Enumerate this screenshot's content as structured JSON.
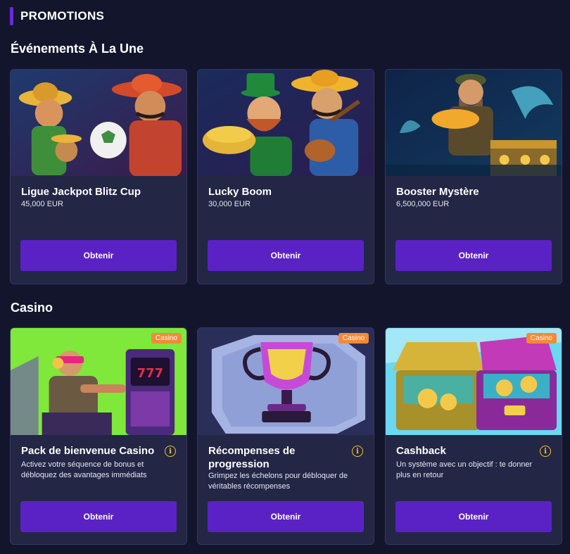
{
  "header": {
    "title": "PROMOTIONS"
  },
  "featured": {
    "title": "Événements À La Une",
    "cards": [
      {
        "title": "Ligue Jackpot Blitz Cup",
        "amount": "45,000 EUR",
        "button": "Obtenir"
      },
      {
        "title": "Lucky Boom",
        "amount": "30,000 EUR",
        "button": "Obtenir"
      },
      {
        "title": "Booster Mystère",
        "amount": "6,500,000 EUR",
        "button": "Obtenir"
      }
    ]
  },
  "casino": {
    "title": "Casino",
    "cards": [
      {
        "badge": "Casino",
        "title": "Pack de bienvenue Casino",
        "description": "Activez votre séquence de bonus et débloquez des avantages immédiats",
        "button": "Obtenir"
      },
      {
        "badge": "Casino",
        "title": "Récompenses de progression",
        "description": "Grimpez les échelons pour débloquer de véritables récompenses",
        "button": "Obtenir"
      },
      {
        "badge": "Casino",
        "title": "Cashback",
        "description": "Un système avec un objectif : te donner plus en retour",
        "button": "Obtenir"
      }
    ]
  },
  "colors": {
    "background": "#13152d",
    "card": "#232645",
    "button": "#5a22c4",
    "badge": "#f28a3a",
    "info": "#f5c32a",
    "accent": "#6a2bd6"
  },
  "icons": {
    "info": "info-icon"
  }
}
